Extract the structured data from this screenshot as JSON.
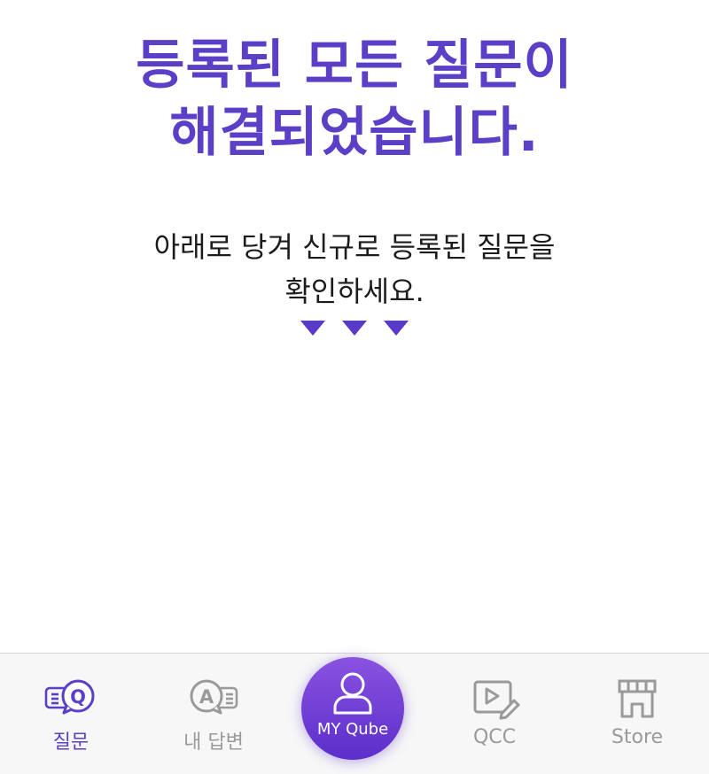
{
  "main": {
    "headline_line1": "등록된 모든 질문이",
    "headline_line2": "해결되었습니다.",
    "sub_line1": "아래로 당겨 신규로 등록된 질문을",
    "sub_line2": "확인하세요."
  },
  "tabbar": {
    "tabs": [
      {
        "label": "질문",
        "icon": "question-chat-icon",
        "active": true
      },
      {
        "label": "내 답변",
        "icon": "answer-chat-icon",
        "active": false
      },
      {
        "label": "MY Qube",
        "icon": "user-icon",
        "active": false
      },
      {
        "label": "QCC",
        "icon": "video-edit-icon",
        "active": false
      },
      {
        "label": "Store",
        "icon": "store-icon",
        "active": false
      }
    ]
  },
  "colors": {
    "accent": "#5b3fc6",
    "inactive": "#9a9a9a",
    "tabbar_bg": "#f7f7f7",
    "fab_top": "#8a52e0",
    "fab_bottom": "#5b2fca"
  }
}
